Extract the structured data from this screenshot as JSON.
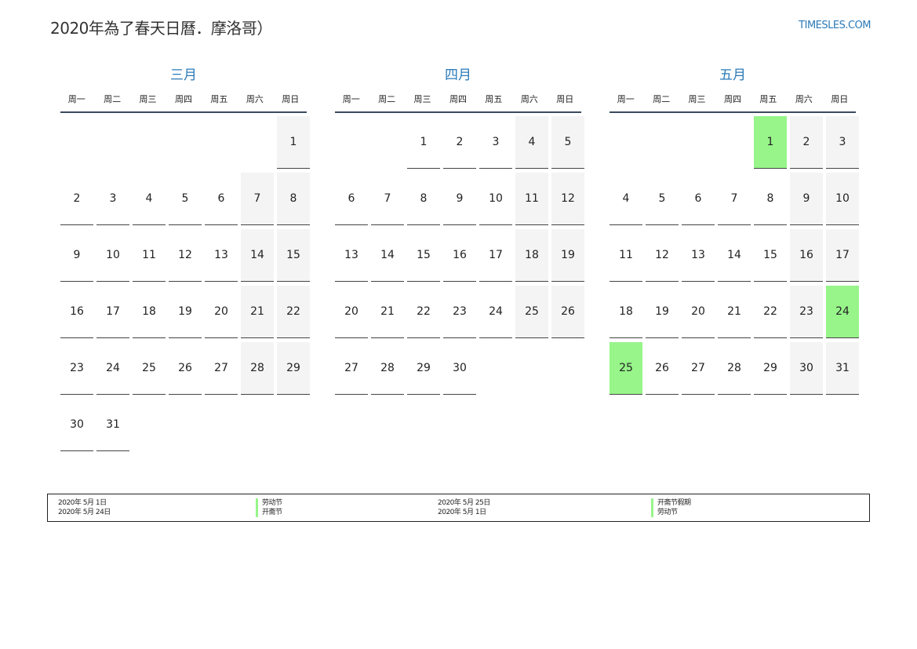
{
  "header": {
    "title": "2020年為了春天日曆．摩洛哥）",
    "site": "TIMESLES.COM"
  },
  "weekday_labels": [
    "周一",
    "周二",
    "周三",
    "周四",
    "周五",
    "周六",
    "周日"
  ],
  "months": [
    {
      "name": "三月",
      "weeks": [
        [
          "",
          "",
          "",
          "",
          "",
          "",
          "1"
        ],
        [
          "2",
          "3",
          "4",
          "5",
          "6",
          "7",
          "8"
        ],
        [
          "9",
          "10",
          "11",
          "12",
          "13",
          "14",
          "15"
        ],
        [
          "16",
          "17",
          "18",
          "19",
          "20",
          "21",
          "22"
        ],
        [
          "23",
          "24",
          "25",
          "26",
          "27",
          "28",
          "29"
        ],
        [
          "30",
          "31",
          "",
          "",
          "",
          "",
          ""
        ]
      ],
      "holidays": []
    },
    {
      "name": "四月",
      "weeks": [
        [
          "",
          "",
          "1",
          "2",
          "3",
          "4",
          "5"
        ],
        [
          "6",
          "7",
          "8",
          "9",
          "10",
          "11",
          "12"
        ],
        [
          "13",
          "14",
          "15",
          "16",
          "17",
          "18",
          "19"
        ],
        [
          "20",
          "21",
          "22",
          "23",
          "24",
          "25",
          "26"
        ],
        [
          "27",
          "28",
          "29",
          "30",
          "",
          "",
          ""
        ]
      ],
      "holidays": []
    },
    {
      "name": "五月",
      "weeks": [
        [
          "",
          "",
          "",
          "",
          "1",
          "2",
          "3"
        ],
        [
          "4",
          "5",
          "6",
          "7",
          "8",
          "9",
          "10"
        ],
        [
          "11",
          "12",
          "13",
          "14",
          "15",
          "16",
          "17"
        ],
        [
          "18",
          "19",
          "20",
          "21",
          "22",
          "23",
          "24"
        ],
        [
          "25",
          "26",
          "27",
          "28",
          "29",
          "30",
          "31"
        ]
      ],
      "holidays": [
        "1",
        "24",
        "25"
      ]
    }
  ],
  "legend": {
    "col1_dates": [
      "2020年 5月 1日",
      "2020年 5月 24日"
    ],
    "col1_names": [
      "劳动节",
      "开斋节"
    ],
    "col2_dates": [
      "2020年 5月 25日",
      "2020年 5月 1日"
    ],
    "col2_names": [
      "开斋节假期",
      "劳动节"
    ]
  },
  "colors": {
    "accent": "#2a7ab8",
    "holiday": "#97f58a",
    "weekend": "#f4f4f4"
  }
}
